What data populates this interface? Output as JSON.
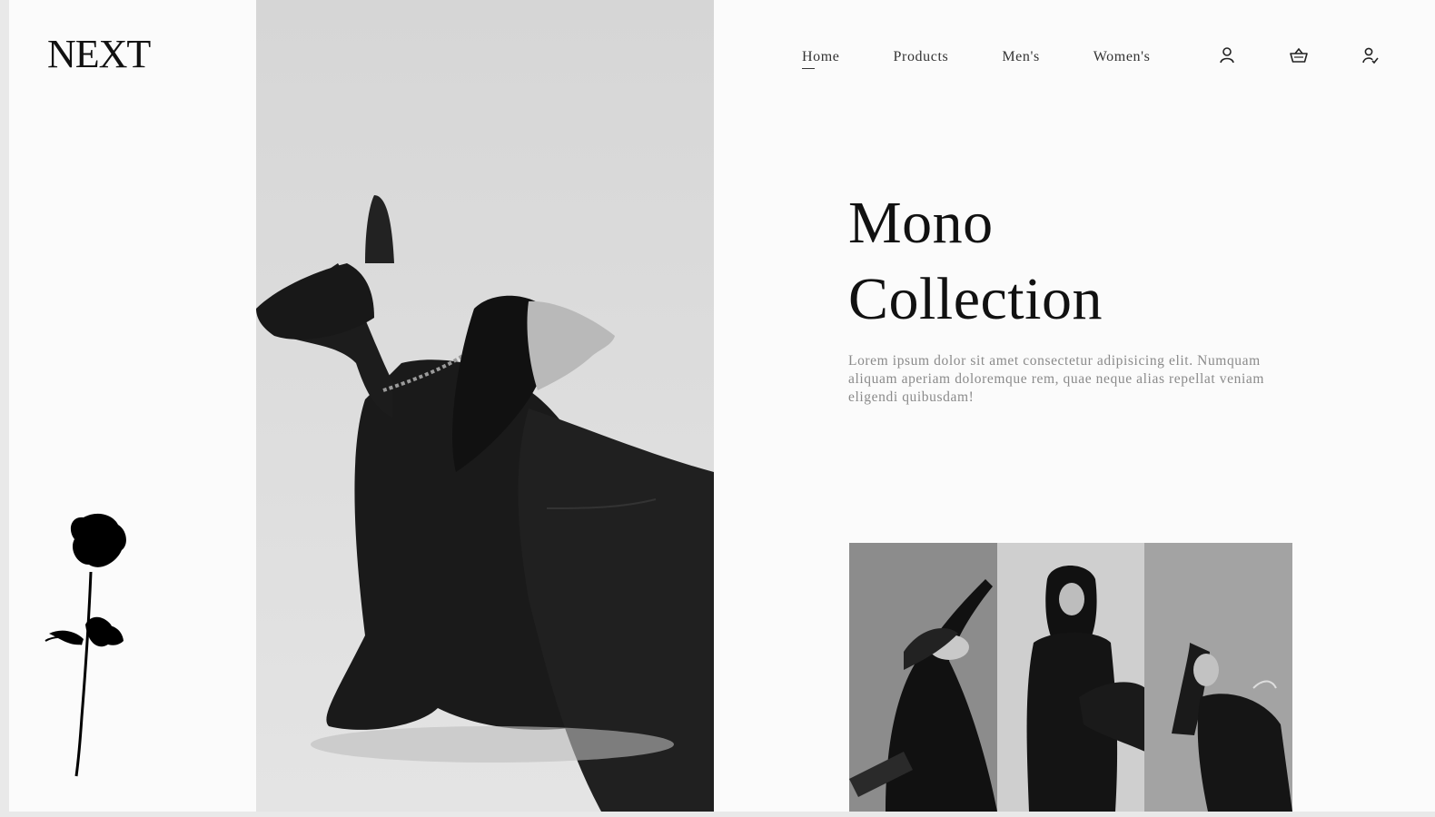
{
  "brand": {
    "logo_text": "NEXT"
  },
  "nav": {
    "links": [
      {
        "label": "Home",
        "active": true
      },
      {
        "label": "Products",
        "active": false
      },
      {
        "label": "Men's",
        "active": false
      },
      {
        "label": "Women's",
        "active": false
      }
    ],
    "icons": [
      "user-icon",
      "basket-icon",
      "user-check-icon"
    ]
  },
  "hero": {
    "title_line1": "Mono",
    "title_line2": "Collection",
    "description": "Lorem ipsum dolor sit amet consectetur adipisicing elit. Numquam aliquam aperiam doloremque rem, quae neque alias repellat veniam eligendi quibusdam!",
    "image": "woman-with-doberman-photo"
  },
  "gallery": {
    "items": [
      "model-photo-1",
      "model-photo-2",
      "model-photo-3"
    ]
  },
  "decor": {
    "rose": "rose-silhouette"
  },
  "colors": {
    "background": "#fbfbfb",
    "text": "#111111",
    "muted": "#8a8a8a"
  }
}
